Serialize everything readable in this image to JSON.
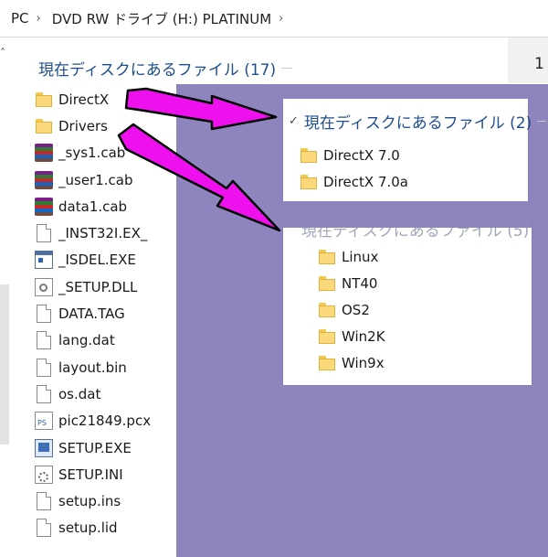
{
  "address_bar": {
    "crumbs": [
      "PC",
      "DVD RW ドライブ (H:) PLATINUM"
    ],
    "separator": "›"
  },
  "main_group": {
    "title": "現在ディスクにあるファイル (17)",
    "right_text": "1"
  },
  "files": [
    {
      "name": "DirectX",
      "icon": "folder-icon"
    },
    {
      "name": "Drivers",
      "icon": "folder-icon"
    },
    {
      "name": "_sys1.cab",
      "icon": "archive-icon"
    },
    {
      "name": "_user1.cab",
      "icon": "archive-icon"
    },
    {
      "name": "data1.cab",
      "icon": "archive-icon"
    },
    {
      "name": "_INST32I.EX_",
      "icon": "document-icon"
    },
    {
      "name": "_ISDEL.EXE",
      "icon": "application-icon"
    },
    {
      "name": "_SETUP.DLL",
      "icon": "settings-document-icon"
    },
    {
      "name": "DATA.TAG",
      "icon": "document-icon"
    },
    {
      "name": "lang.dat",
      "icon": "document-icon"
    },
    {
      "name": "layout.bin",
      "icon": "document-icon"
    },
    {
      "name": "os.dat",
      "icon": "document-icon"
    },
    {
      "name": "pic21849.pcx",
      "icon": "image-icon"
    },
    {
      "name": "SETUP.EXE",
      "icon": "setup-icon"
    },
    {
      "name": "SETUP.INI",
      "icon": "config-icon"
    },
    {
      "name": "setup.ins",
      "icon": "document-icon"
    },
    {
      "name": "setup.lid",
      "icon": "document-icon"
    }
  ],
  "popup_directx": {
    "title": "現在ディスクにあるファイル (2)",
    "chevron": "✓",
    "items": [
      "DirectX 7.0",
      "DirectX 7.0a"
    ]
  },
  "popup_drivers": {
    "title": "現在ディスクにあるファイル (5)",
    "items": [
      "Linux",
      "NT40",
      "OS2",
      "Win2K",
      "Win9x"
    ]
  },
  "colors": {
    "overlay": "#8e85bf",
    "arrow_fill": "#ee11ee",
    "arrow_stroke": "#000000",
    "header_blue": "#1f4e8c"
  }
}
